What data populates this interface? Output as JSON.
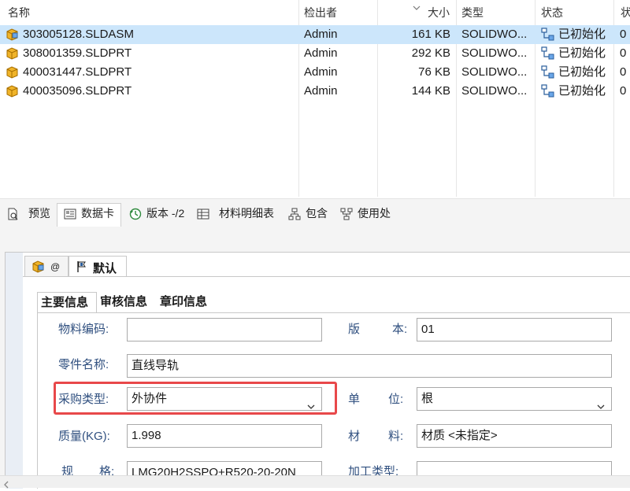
{
  "file_list": {
    "headers": {
      "name": "名称",
      "checked_out_by": "检出者",
      "size": "大小",
      "type": "类型",
      "state": "状态",
      "extra": "状"
    },
    "rows": [
      {
        "name": "303005128.SLDASM",
        "checked_out_by": "Admin",
        "size": "161 KB",
        "type": "SOLIDWO...",
        "state": "已初始化",
        "extra": "0",
        "selected": true,
        "icon": "assembly-icon"
      },
      {
        "name": "308001359.SLDPRT",
        "checked_out_by": "Admin",
        "size": "292 KB",
        "type": "SOLIDWO...",
        "state": "已初始化",
        "extra": "0",
        "selected": false,
        "icon": "part-icon"
      },
      {
        "name": "400031447.SLDPRT",
        "checked_out_by": "Admin",
        "size": "76 KB",
        "type": "SOLIDWO...",
        "state": "已初始化",
        "extra": "0",
        "selected": false,
        "icon": "part-icon"
      },
      {
        "name": "400035096.SLDPRT",
        "checked_out_by": "Admin",
        "size": "144 KB",
        "type": "SOLIDWO...",
        "state": "已初始化",
        "extra": "0",
        "selected": false,
        "icon": "part-icon"
      }
    ]
  },
  "tabs": [
    {
      "label": "预览",
      "icon": "preview-icon",
      "active": false
    },
    {
      "label": "数据卡",
      "icon": "datacard-icon",
      "active": true
    },
    {
      "label": "版本 -/2",
      "icon": "version-icon",
      "active": false
    },
    {
      "label": "材料明细表",
      "icon": "bom-icon",
      "active": false
    },
    {
      "label": "包含",
      "icon": "contains-icon",
      "active": false
    },
    {
      "label": "使用处",
      "icon": "where-used-icon",
      "active": false
    }
  ],
  "config_tabs": {
    "at_label": "@",
    "default_label": "默认"
  },
  "info_tabs": [
    "主要信息",
    "审核信息",
    "章印信息"
  ],
  "form": {
    "material_code_label": "物料编码:",
    "material_code_value": "",
    "version_label_1": "版",
    "version_label_2": "本:",
    "version_value": "01",
    "part_name_label": "零件名称:",
    "part_name_value": "直线导轨",
    "purchase_type_label": "采购类型:",
    "purchase_type_value": "外协件",
    "unit_label_1": "单",
    "unit_label_2": "位:",
    "unit_value": "根",
    "mass_label": "质量(KG):",
    "mass_value": "1.998",
    "material_label_1": "材",
    "material_label_2": "料:",
    "material_value": "材质 <未指定>",
    "spec_label_1": "规",
    "spec_label_2": "格:",
    "spec_value": "LMG20H2SSPO+R520-20-20N",
    "process_type_label": "加工类型:",
    "process_type_value": ""
  },
  "colors": {
    "selected_row": "#cce6fb",
    "highlight_box": "#e8484a",
    "label_text": "#2f4f7f"
  }
}
